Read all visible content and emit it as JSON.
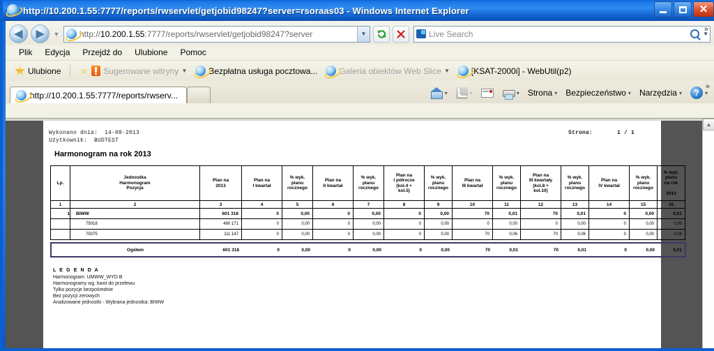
{
  "window": {
    "title": "http://10.200.1.55:7777/reports/rwservlet/getjobid98247?server=rsoraas03 - Windows Internet Explorer",
    "minimize_label": "Minimalizuj",
    "maximize_label": "Maksymalizuj",
    "close_label": "Zamknij"
  },
  "address_bar": {
    "back_label": "◀",
    "forward_label": "▶",
    "history_caret": "▼",
    "url_host": "10.200.1.55",
    "url_rest": ":7777/reports/rwservlet/getjobid98247?server",
    "url_full": "http://10.200.1.55:7777/reports/rwservlet/getjobid98247?server=rsoraas03",
    "dropdown_caret": "▼",
    "refresh_label": "↻",
    "stop_label": "✕",
    "search_placeholder": "Live Search",
    "search_value": "",
    "search_go_caret": "▾"
  },
  "menu": {
    "items": [
      {
        "label": "Plik"
      },
      {
        "label": "Edycja"
      },
      {
        "label": "Przejdź do"
      },
      {
        "label": "Ulubione"
      },
      {
        "label": "Pomoc"
      }
    ]
  },
  "favorites_bar": {
    "favorites_label": "Ulubione",
    "items": [
      {
        "label": "Sugerowane witryny",
        "caret": "▼",
        "dim": true
      },
      {
        "label": "Bezpłatna usługa pocztowa...",
        "caret": "",
        "dim": false
      },
      {
        "label": "Galeria obiektów Web Slice",
        "caret": "▼",
        "dim": true
      },
      {
        "label": "[KSAT-2000i] - WebUtil(p2)",
        "caret": "",
        "dim": false
      }
    ]
  },
  "tabs": {
    "active_tab_label": "http://10.200.1.55:7777/reports/rwserv...",
    "new_tab_label": ""
  },
  "command_bar": {
    "items": [
      {
        "label": "",
        "icon": "home-icon",
        "caret": "▾"
      },
      {
        "label": "",
        "icon": "rss-feed-icon",
        "caret": "▾"
      },
      {
        "label": "",
        "icon": "read-mail-icon",
        "caret": ""
      },
      {
        "label": "",
        "icon": "print-icon",
        "caret": "▾"
      },
      {
        "label": "Strona",
        "icon": "",
        "caret": "▾"
      },
      {
        "label": "Bezpieczeństwo",
        "icon": "",
        "caret": "▾"
      },
      {
        "label": "Narzędzia",
        "icon": "",
        "caret": "▾"
      },
      {
        "label": "",
        "icon": "help-icon",
        "caret": "▾"
      }
    ],
    "overflow_label": "»"
  },
  "report": {
    "generated_label": "Wykonano dnia:",
    "generated_date": "14-08-2013",
    "user_label": "Użytkownik:",
    "user_value": "BUDTEST",
    "page_label": "Strona:",
    "page_value": "1 / 1",
    "title": "Harmonogram na rok 2013",
    "columns": [
      {
        "num": "1",
        "title": "Lp."
      },
      {
        "num": "2",
        "title": "Jednostka\nHarmonogram\nPozycja"
      },
      {
        "num": "3",
        "title": "Plan na\n2013"
      },
      {
        "num": "4",
        "title": "Plan na\nI kwartał"
      },
      {
        "num": "5",
        "title": "% wyk.\nplanu\nrocznego"
      },
      {
        "num": "6",
        "title": "Plan na\nII kwartał"
      },
      {
        "num": "7",
        "title": "% wyk.\nplanu\nrocznego"
      },
      {
        "num": "8",
        "title": "Plan na\nI półrocze\n(kol.4 +\nkol.5)"
      },
      {
        "num": "9",
        "title": "% wyk.\nplanu\nrocznego"
      },
      {
        "num": "10",
        "title": "Plan na\nIII kwartał"
      },
      {
        "num": "11",
        "title": "% wyk.\nplanu\nrocznego"
      },
      {
        "num": "12",
        "title": "Plan na\nIII kwartały\n(kol.8 +\nkol.10)"
      },
      {
        "num": "13",
        "title": "% wyk.\nplanu\nrocznego"
      },
      {
        "num": "14",
        "title": "Plan na\nIV kwartał"
      },
      {
        "num": "15",
        "title": "% wyk.\nplanu\nrocznego"
      },
      {
        "num": "16",
        "title": "% wyk.\nplanu\nna rok\n\n2013"
      }
    ],
    "rows": [
      {
        "lp": "1",
        "name": "BIWW",
        "level": "main",
        "cells": [
          "601 318",
          "0",
          "0,00",
          "0",
          "0,00",
          "0",
          "0,00",
          "70",
          "0,01",
          "70",
          "0,01",
          "0",
          "0,00",
          "0,01"
        ]
      },
      {
        "lp": "",
        "name": "75018",
        "level": "sub",
        "cells": [
          "490 171",
          "0",
          "0,00",
          "0",
          "0,00",
          "0",
          "0,00",
          "0",
          "0,00",
          "0",
          "0,00",
          "0",
          "0,00",
          "0,00"
        ]
      },
      {
        "lp": "",
        "name": "75075",
        "level": "sub",
        "cells": [
          "111 147",
          "0",
          "0,00",
          "0",
          "0,00",
          "0",
          "0,00",
          "70",
          "0,06",
          "70",
          "0,06",
          "0",
          "0,00",
          "0,06"
        ]
      }
    ],
    "total": {
      "label": "Ogółem",
      "cells": [
        "601 318",
        "0",
        "0,00",
        "0",
        "0,00",
        "0",
        "0,00",
        "70",
        "0,01",
        "70",
        "0,01",
        "0",
        "0,00",
        "0,01"
      ]
    },
    "legend": {
      "title": "L E G E N D A",
      "lines": [
        "Harmonogram: UMWW_WYD B",
        "Harmonogramy wg. kwot do przelewu",
        "Tylko pozycje bezpośrednie",
        "Bez pozycji zerowych",
        "Analizowane jednostki -  Wybrana jednostka: BIWW"
      ]
    }
  },
  "scrollbar": {
    "up_arrow": "▲",
    "down_arrow": "▼"
  },
  "colors": {
    "titlebar_blue": "#0a60d2",
    "chrome_beige": "#f2f1e6",
    "page_gray": "#545454",
    "paper_white": "#ffffff",
    "total_border": "#3a3a66"
  }
}
